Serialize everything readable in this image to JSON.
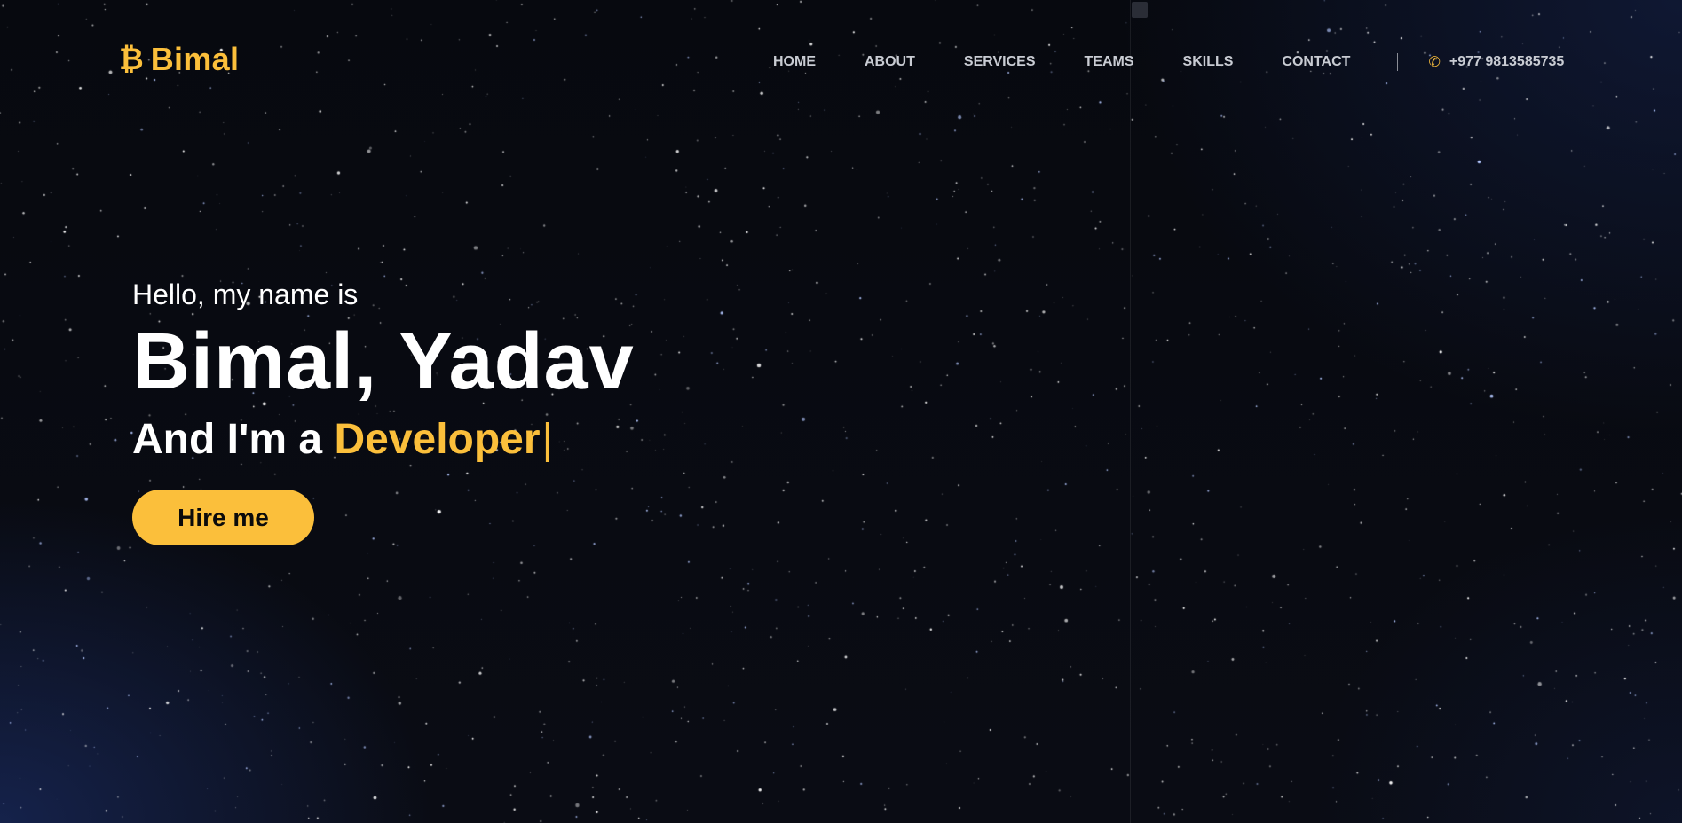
{
  "brand": {
    "icon": "bitcoin-icon",
    "icon_glyph": "₿",
    "name": "Bimal",
    "accent_color": "#fbbf3b"
  },
  "nav": {
    "items": [
      "HOME",
      "ABOUT",
      "SERVICES",
      "TEAMS",
      "SKILLS",
      "CONTACT"
    ],
    "phone": {
      "icon": "phone-icon",
      "icon_glyph": "✆",
      "number": "+977 9813585735"
    }
  },
  "hero": {
    "greeting": "Hello, my name is",
    "name": "Bimal, Yadav",
    "role_prefix": "And I'm a",
    "role": "Developer",
    "cursor": "|",
    "cta_label": "Hire me"
  },
  "colors": {
    "background": "#05070d",
    "text": "#ffffff",
    "nav_text": "#c9ccd3",
    "accent": "#fbbf3b"
  }
}
